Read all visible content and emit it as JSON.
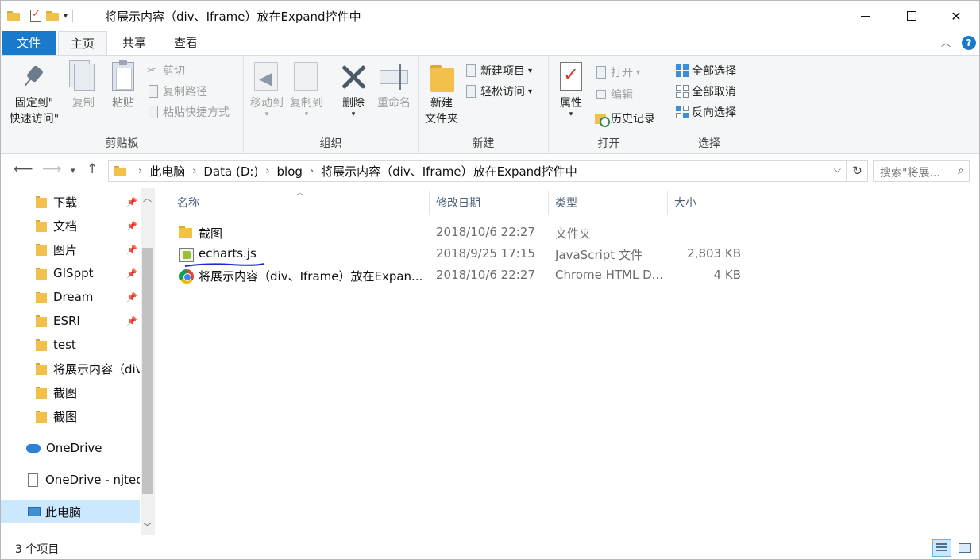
{
  "window": {
    "title": "将展示内容（div、Iframe）放在Expand控件中",
    "colors": {
      "accent": "#1979ca",
      "selection": "#cce8ff",
      "folder": "#f2c14b"
    }
  },
  "ribbon_tabs": {
    "file": "文件",
    "home": "主页",
    "share": "共享",
    "view": "查看"
  },
  "clipboard": {
    "pin_line1": "固定到\"",
    "pin_line2": "快速访问\"",
    "copy": "复制",
    "paste": "粘贴",
    "cut": "剪切",
    "copy_path": "复制路径",
    "paste_shortcut": "粘贴快捷方式",
    "label": "剪贴板"
  },
  "organize": {
    "move_to": "移动到",
    "copy_to": "复制到",
    "delete": "删除",
    "rename": "重命名",
    "label": "组织"
  },
  "new_group": {
    "new_folder_line1": "新建",
    "new_folder_line2": "文件夹",
    "new_item": "新建项目",
    "easy_access": "轻松访问",
    "label": "新建"
  },
  "open_group": {
    "properties": "属性",
    "open": "打开",
    "edit": "编辑",
    "history": "历史记录",
    "label": "打开"
  },
  "select_group": {
    "select_all": "全部选择",
    "select_none": "全部取消",
    "invert": "反向选择",
    "label": "选择"
  },
  "address": {
    "crumbs": [
      "此电脑",
      "Data (D:)",
      "blog",
      "将展示内容（div、Iframe）放在Expand控件中"
    ],
    "search_placeholder": "搜索\"将展..."
  },
  "nav_pane": {
    "quick_access": [
      {
        "label": "下载",
        "pinned": true
      },
      {
        "label": "文档",
        "pinned": true
      },
      {
        "label": "图片",
        "pinned": true
      },
      {
        "label": "GISppt",
        "pinned": true
      },
      {
        "label": "Dream",
        "pinned": true
      },
      {
        "label": "ESRI",
        "pinned": true
      },
      {
        "label": "test",
        "pinned": false
      },
      {
        "label": "将展示内容（div",
        "pinned": false
      },
      {
        "label": "截图",
        "pinned": false
      },
      {
        "label": "截图",
        "pinned": false
      }
    ],
    "onedrive": "OneDrive",
    "onedrive_org": "OneDrive - njtec",
    "this_pc": "此电脑"
  },
  "columns": {
    "name": "名称",
    "modified": "修改日期",
    "type": "类型",
    "size": "大小"
  },
  "files": [
    {
      "name": "截图",
      "modified": "2018/10/6 22:27",
      "type": "文件夹",
      "size": "",
      "icon": "folder-icon"
    },
    {
      "name": "echarts.js",
      "modified": "2018/9/25 17:15",
      "type": "JavaScript 文件",
      "size": "2,803 KB",
      "icon": "js-file-icon"
    },
    {
      "name": "将展示内容（div、Iframe）放在Expan...",
      "modified": "2018/10/6 22:27",
      "type": "Chrome HTML D...",
      "size": "4 KB",
      "icon": "chrome-icon"
    }
  ],
  "status": {
    "item_count": "3 个项目"
  }
}
